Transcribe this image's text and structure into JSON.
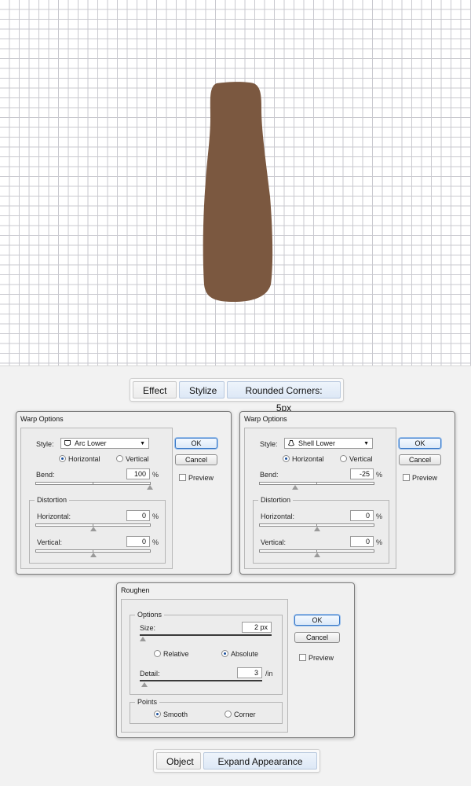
{
  "canvas": {
    "shape_color": "#7b5840",
    "grid_color": "#c9c9cf"
  },
  "menu1": {
    "items": [
      "Effect",
      "Stylize",
      "Rounded Corners: 5px"
    ]
  },
  "warp1": {
    "title": "Warp Options",
    "style_label": "Style:",
    "style_value": "Arc Lower",
    "style_icon": "arc-lower-icon",
    "horizontal_label": "Horizontal",
    "vertical_label": "Vertical",
    "orientation": "Horizontal",
    "bend_label": "Bend:",
    "bend_value": "100",
    "bend_unit": "%",
    "distortion_title": "Distortion",
    "dist_h_label": "Horizontal:",
    "dist_h_value": "0",
    "dist_h_unit": "%",
    "dist_v_label": "Vertical:",
    "dist_v_value": "0",
    "dist_v_unit": "%",
    "ok": "OK",
    "cancel": "Cancel",
    "preview": "Preview"
  },
  "warp2": {
    "title": "Warp Options",
    "style_label": "Style:",
    "style_value": "Shell Lower",
    "style_icon": "shell-lower-icon",
    "horizontal_label": "Horizontal",
    "vertical_label": "Vertical",
    "orientation": "Horizontal",
    "bend_label": "Bend:",
    "bend_value": "-25",
    "bend_unit": "%",
    "distortion_title": "Distortion",
    "dist_h_label": "Horizontal:",
    "dist_h_value": "0",
    "dist_h_unit": "%",
    "dist_v_label": "Vertical:",
    "dist_v_value": "0",
    "dist_v_unit": "%",
    "ok": "OK",
    "cancel": "Cancel",
    "preview": "Preview"
  },
  "roughen": {
    "title": "Roughen",
    "options_title": "Options",
    "size_label": "Size:",
    "size_value": "2 px",
    "relative_label": "Relative",
    "absolute_label": "Absolute",
    "size_mode": "Absolute",
    "detail_label": "Detail:",
    "detail_value": "3",
    "detail_unit": "/in",
    "points_title": "Points",
    "smooth_label": "Smooth",
    "corner_label": "Corner",
    "points_mode": "Smooth",
    "ok": "OK",
    "cancel": "Cancel",
    "preview": "Preview"
  },
  "menu2": {
    "items": [
      "Object",
      "Expand Appearance"
    ]
  }
}
